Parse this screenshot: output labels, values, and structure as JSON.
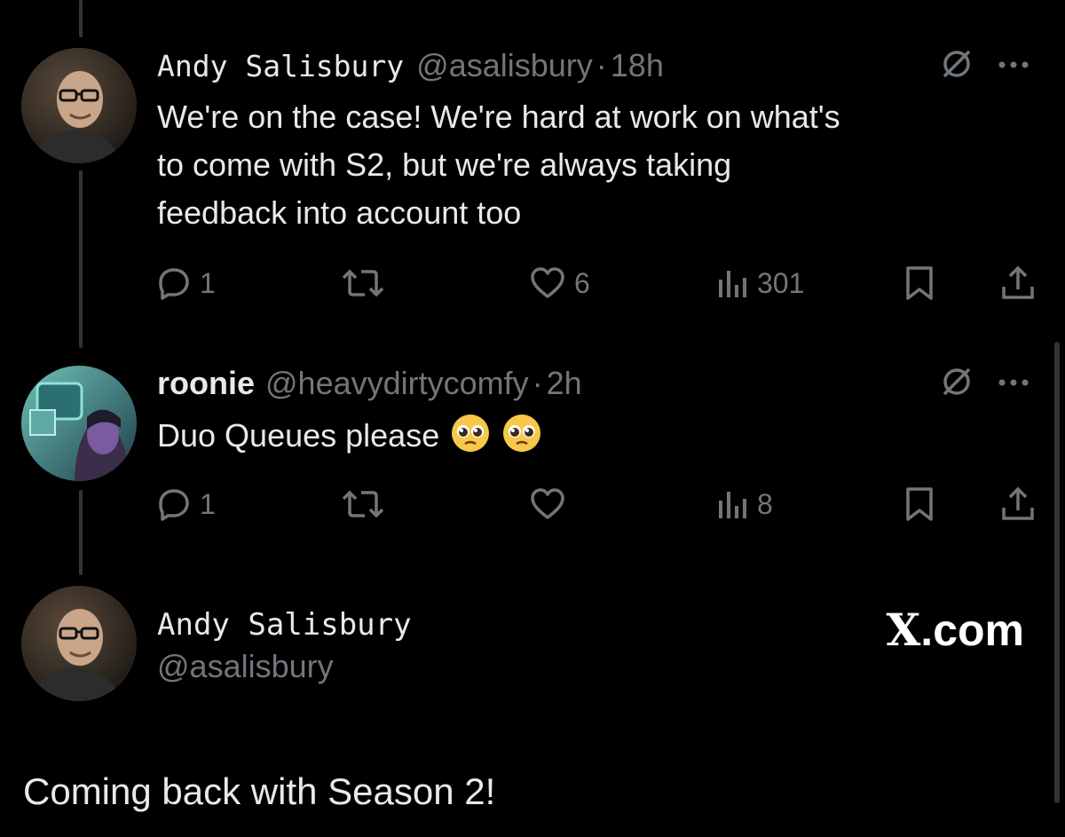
{
  "tweets": [
    {
      "name": "Andy Salisbury",
      "handle": "@asalisbury",
      "separator": "·",
      "time": "18h",
      "lines": [
        "We're on the case! We're hard at work on what's",
        "to come with S2, but we're always taking",
        "feedback into account too"
      ],
      "replies": "1",
      "retweets": "",
      "likes": "6",
      "views": "301"
    },
    {
      "name": "roonie",
      "handle": "@heavydirtycomfy",
      "separator": "·",
      "time": "2h",
      "text": "Duo Queues please",
      "emoji": [
        "pleading-face",
        "pleading-face"
      ],
      "replies": "1",
      "retweets": "",
      "likes": "",
      "views": "8"
    }
  ],
  "card": {
    "name": "Andy Salisbury",
    "handle": "@asalisbury",
    "brand_x": "X",
    "brand_suffix": ".com",
    "quote": "Coming back with Season 2!"
  },
  "icons": [
    "grok-icon",
    "more-icon",
    "reply-icon",
    "retweet-icon",
    "like-icon",
    "views-icon",
    "bookmark-icon",
    "share-icon"
  ],
  "colors": {
    "background": "#000000",
    "text": "#e7e9ea",
    "muted": "#71767b",
    "line": "#333639"
  }
}
